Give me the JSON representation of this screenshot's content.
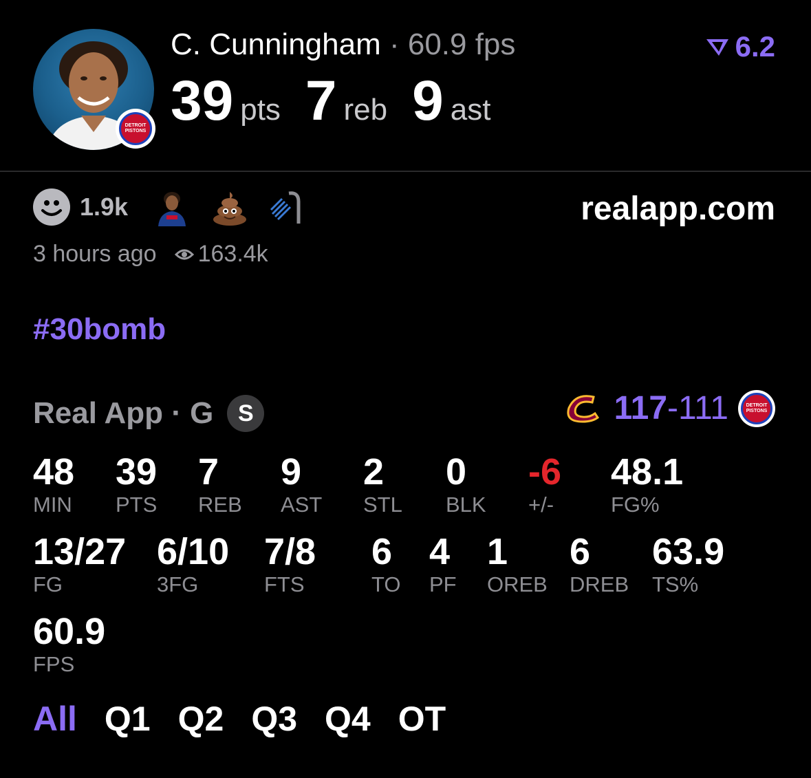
{
  "header": {
    "player_name": "C. Cunningham",
    "separator": " · ",
    "fps_text": "60.9 fps",
    "rating": "6.2",
    "stats": [
      {
        "value": "39",
        "unit": "pts"
      },
      {
        "value": "7",
        "unit": "reb"
      },
      {
        "value": "9",
        "unit": "ast"
      }
    ],
    "team_badge_text": "DETROIT PISTONS"
  },
  "reactions": {
    "count": "1.9k",
    "icons": [
      "smiley-icon",
      "player-emoji",
      "poop-emoji",
      "shower-emoji"
    ]
  },
  "site": "realapp.com",
  "meta": {
    "time_ago": "3 hours ago",
    "views": "163.4k"
  },
  "hashtag": "#30bomb",
  "game": {
    "league": "Real App · G",
    "badge": "S",
    "score_winner": "117",
    "score_dash": "-",
    "score_loser": "111"
  },
  "stats_row1": [
    {
      "value": "48",
      "label": "MIN"
    },
    {
      "value": "39",
      "label": "PTS"
    },
    {
      "value": "7",
      "label": "REB"
    },
    {
      "value": "9",
      "label": "AST"
    },
    {
      "value": "2",
      "label": "STL"
    },
    {
      "value": "0",
      "label": "BLK"
    },
    {
      "value": "-6",
      "label": "+/-"
    },
    {
      "value": "48.1",
      "label": "FG%"
    }
  ],
  "stats_row2": [
    {
      "value": "13/27",
      "label": "FG"
    },
    {
      "value": "6/10",
      "label": "3FG"
    },
    {
      "value": "7/8",
      "label": "FTS"
    },
    {
      "value": "6",
      "label": "TO"
    },
    {
      "value": "4",
      "label": "PF"
    },
    {
      "value": "1",
      "label": "OREB"
    },
    {
      "value": "6",
      "label": "DREB"
    },
    {
      "value": "63.9",
      "label": "TS%"
    }
  ],
  "stats_row3": [
    {
      "value": "60.9",
      "label": "FPS"
    }
  ],
  "tabs": [
    "All",
    "Q1",
    "Q2",
    "Q3",
    "Q4",
    "OT"
  ],
  "colors": {
    "accent": "#8b6cf4",
    "negative": "#e5262c",
    "muted": "#8e8e93"
  }
}
